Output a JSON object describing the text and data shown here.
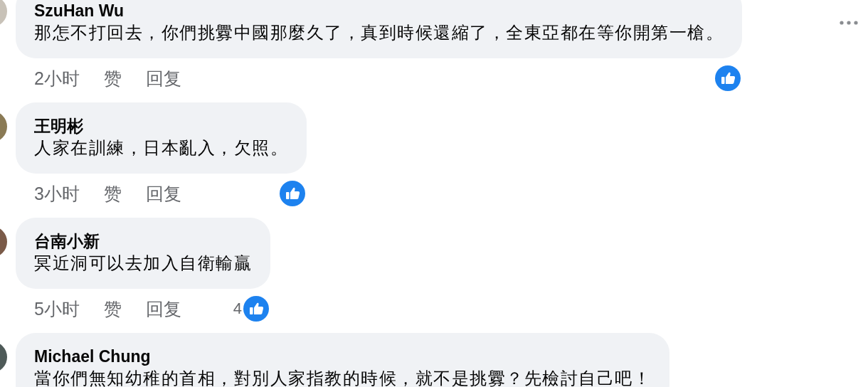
{
  "comments": [
    {
      "author": "SzuHan Wu",
      "text": "那怎不打回去，你們挑釁中國那麼久了，真到時候還縮了，全東亞都在等你開第一槍。",
      "time": "2小时",
      "like_label": "赞",
      "reply_label": "回复",
      "has_reaction": true,
      "more_menu": true
    },
    {
      "author": "王明彬",
      "text": "人家在訓練，日本亂入，欠照。",
      "time": "3小时",
      "like_label": "赞",
      "reply_label": "回复",
      "has_reaction": true
    },
    {
      "author": "台南小新",
      "text": "冥近洞可以去加入自衛輸贏",
      "time": "5小时",
      "like_label": "赞",
      "reply_label": "回复",
      "has_reaction": true,
      "reaction_count": "4"
    },
    {
      "author": "Michael Chung",
      "text": "當你們無知幼稚的首相，對別人家指教的時候，就不是挑釁？先檢討自己吧！"
    }
  ]
}
